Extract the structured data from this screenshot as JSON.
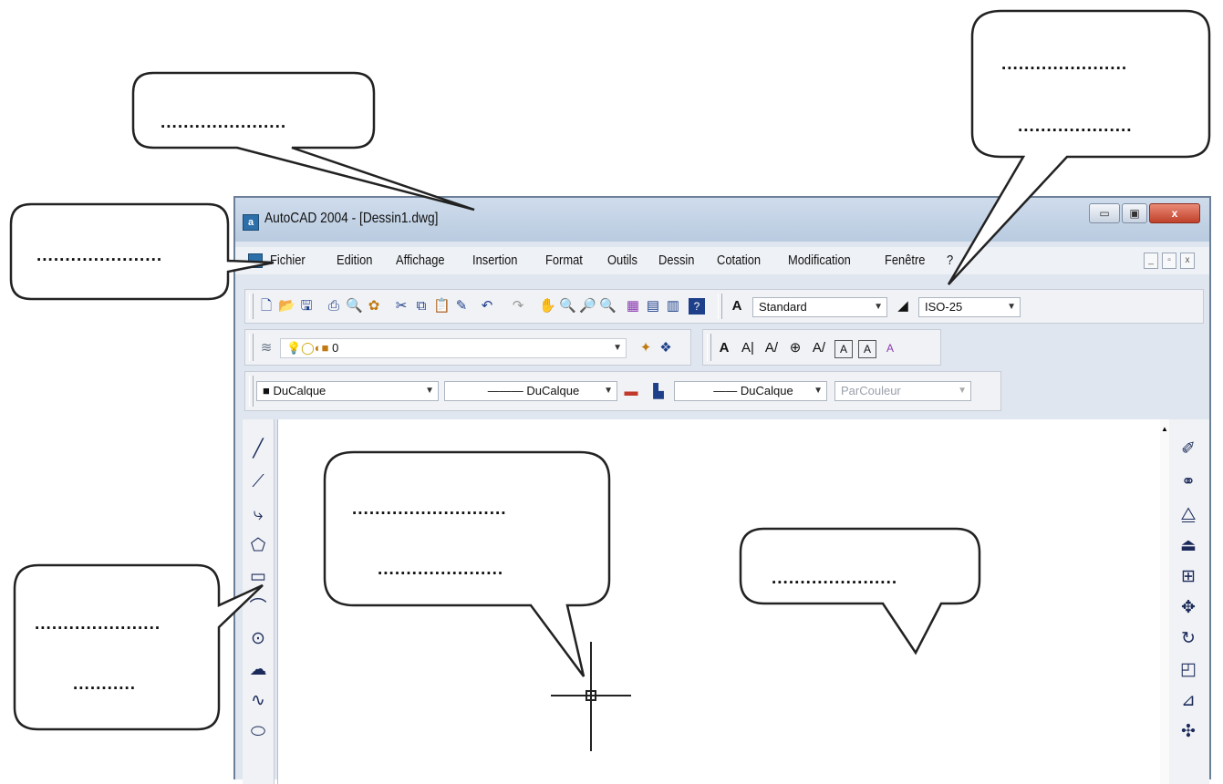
{
  "window": {
    "title": "AutoCAD 2004 - [Dessin1.dwg]",
    "app_icon_glyph": "a",
    "minimize_glyph": "▭",
    "maximize_glyph": "▣",
    "close_glyph": "x"
  },
  "menu": {
    "items": [
      "Fichier",
      "Edition",
      "Affichage",
      "Insertion",
      "Format",
      "Outils",
      "Dessin",
      "Cotation",
      "Modification",
      "Fenêtre"
    ],
    "help_glyph": "?",
    "mdi_minimize": "_",
    "mdi_restore": "▫",
    "mdi_close": "x"
  },
  "toolbar_standard": {
    "style_combo": "Standard",
    "dim_combo": "ISO-25"
  },
  "toolbar_layers": {
    "layer_combo": "0"
  },
  "toolbar_text": {
    "icons": [
      "A",
      "A|",
      "A/",
      "⊕",
      "A/",
      "A",
      "A",
      "A"
    ]
  },
  "toolbar_properties": {
    "color_combo": "DuCalque",
    "linetype_combo": "DuCalque",
    "lineweight_combo": "DuCalque",
    "plotstyle_combo": "ParCouleur"
  },
  "draw_toolbar": {
    "icons": [
      "line-icon",
      "construction-line-icon",
      "polyline-icon",
      "polygon-icon",
      "rectangle-icon",
      "arc-icon",
      "circle-icon",
      "revision-cloud-icon",
      "spline-icon",
      "ellipse-icon"
    ]
  },
  "modify_toolbar": {
    "icons": [
      "erase-icon",
      "copy-icon",
      "mirror-icon",
      "offset-icon",
      "array-icon",
      "move-icon",
      "rotate-icon",
      "scale-icon",
      "stretch-icon",
      "trim-icon"
    ]
  },
  "callouts": {
    "title_bar": "......................",
    "menu_bar": "......................",
    "styles_1": "......................",
    "styles_2": "....................",
    "crosshair_1": "...........................",
    "crosshair_2": "......................",
    "draw_area": "......................",
    "draw_toolbar_1": "......................",
    "draw_toolbar_2": "..........."
  }
}
